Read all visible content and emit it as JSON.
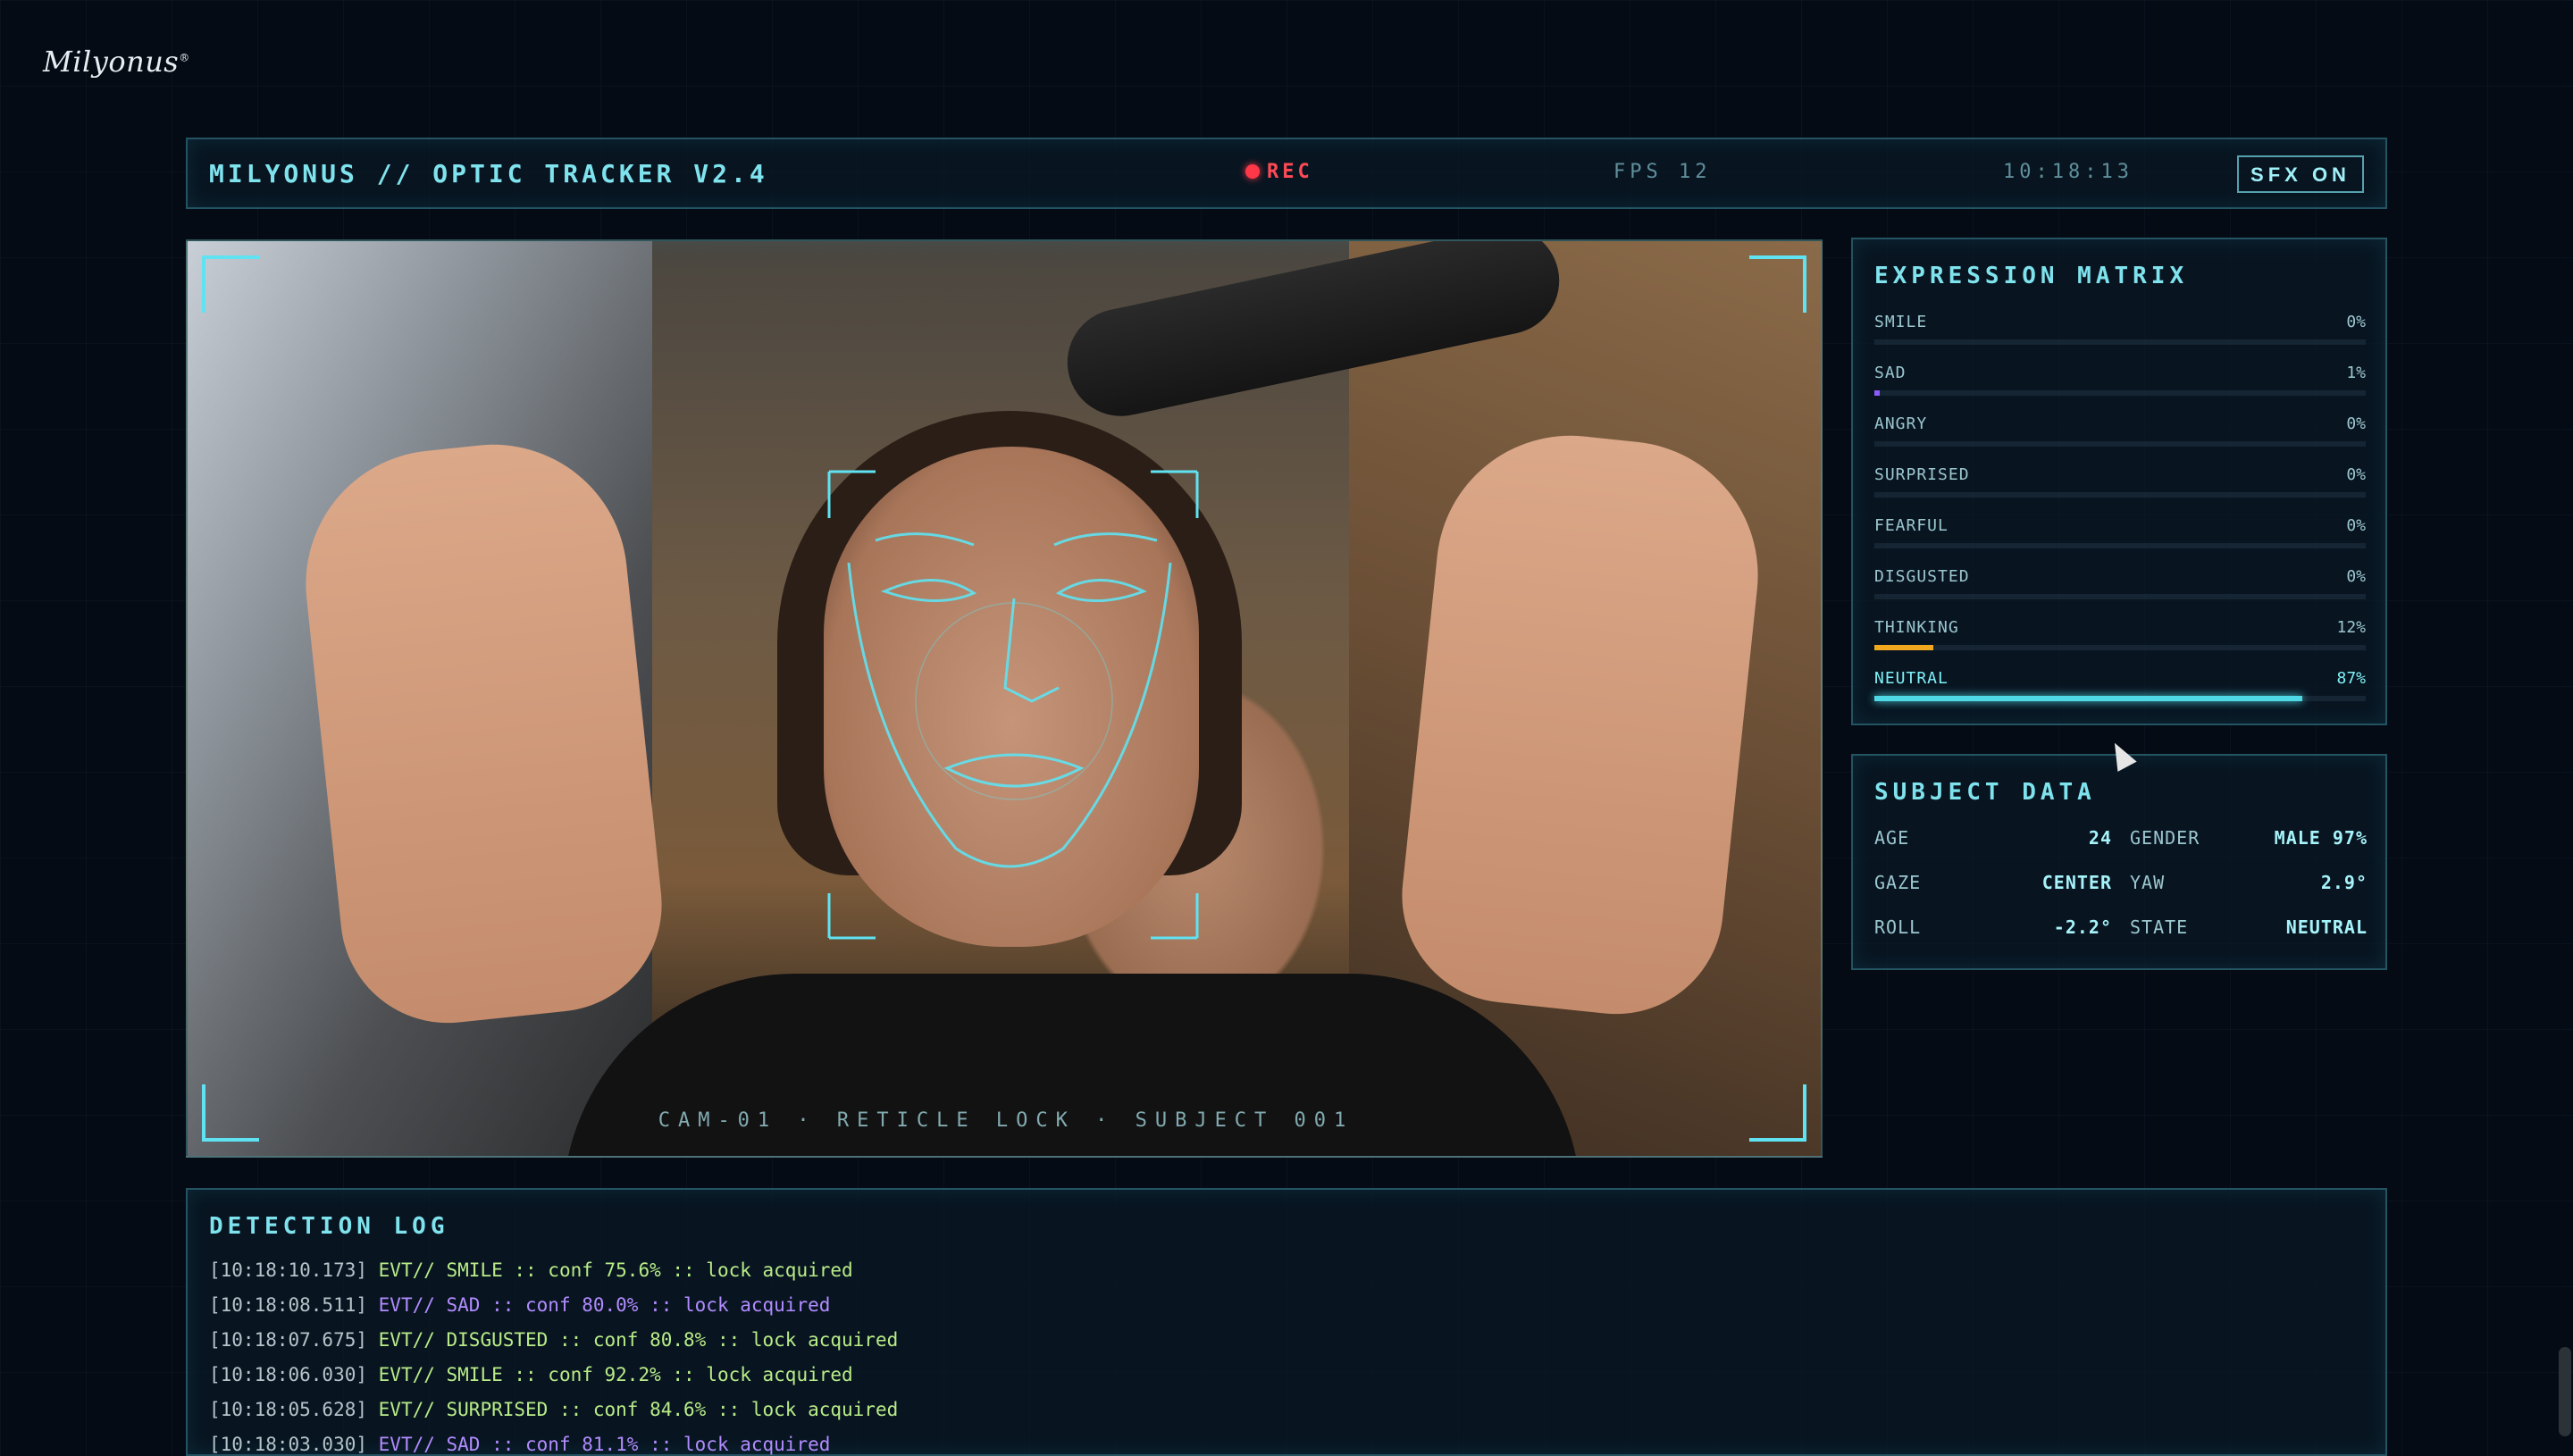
{
  "brand": {
    "logo": "Milyonus",
    "trademark": "®"
  },
  "topbar": {
    "title": "MILYONUS // OPTIC TRACKER V2.4",
    "rec_label": "REC",
    "fps": "FPS 12",
    "clock": "10:18:13",
    "sfx_button": "SFX ON"
  },
  "video": {
    "caption": "CAM-01 · RETICLE LOCK · SUBJECT 001"
  },
  "expression_matrix": {
    "title": "EXPRESSION MATRIX",
    "items": [
      {
        "label": "SMILE",
        "value": "0%",
        "level": 0,
        "color": "#3a6a80"
      },
      {
        "label": "SAD",
        "value": "1%",
        "level": 0.01,
        "color": "#8a5cff"
      },
      {
        "label": "ANGRY",
        "value": "0%",
        "level": 0,
        "color": "#e84a4a"
      },
      {
        "label": "SURPRISED",
        "value": "0%",
        "level": 0,
        "color": "#3a6a80"
      },
      {
        "label": "FEARFUL",
        "value": "0%",
        "level": 0,
        "color": "#3a6a80"
      },
      {
        "label": "DISGUSTED",
        "value": "0%",
        "level": 0,
        "color": "#3a6a80"
      },
      {
        "label": "THINKING",
        "value": "12%",
        "level": 0.12,
        "color": "#f2a81e"
      },
      {
        "label": "NEUTRAL",
        "value": "87%",
        "level": 0.87,
        "color": "#4fd9e6"
      }
    ]
  },
  "subject_data": {
    "title": "SUBJECT DATA",
    "fields": [
      {
        "label": "AGE",
        "value": "24"
      },
      {
        "label": "GENDER",
        "value": "MALE 97%"
      },
      {
        "label": "GAZE",
        "value": "CENTER"
      },
      {
        "label": "YAW",
        "value": "2.9°"
      },
      {
        "label": "ROLL",
        "value": "-2.2°"
      },
      {
        "label": "STATE",
        "value": "NEUTRAL"
      }
    ]
  },
  "detection_log": {
    "title": "DETECTION LOG",
    "entries": [
      {
        "ts": "[10:18:10.173]",
        "text": " EVT// SMILE :: conf 75.6% :: lock acquired",
        "kind": "ok"
      },
      {
        "ts": "[10:18:08.511]",
        "text": " EVT// SAD :: conf 80.0% :: lock acquired",
        "kind": "sad"
      },
      {
        "ts": "[10:18:07.675]",
        "text": " EVT// DISGUSTED :: conf 80.8% :: lock acquired",
        "kind": "ok"
      },
      {
        "ts": "[10:18:06.030]",
        "text": " EVT// SMILE :: conf 92.2% :: lock acquired",
        "kind": "ok"
      },
      {
        "ts": "[10:18:05.628]",
        "text": " EVT// SURPRISED :: conf 84.6% :: lock acquired",
        "kind": "ok"
      },
      {
        "ts": "[10:18:03.030]",
        "text": " EVT// SAD :: conf 81.1% :: lock acquired",
        "kind": "sad"
      }
    ]
  }
}
